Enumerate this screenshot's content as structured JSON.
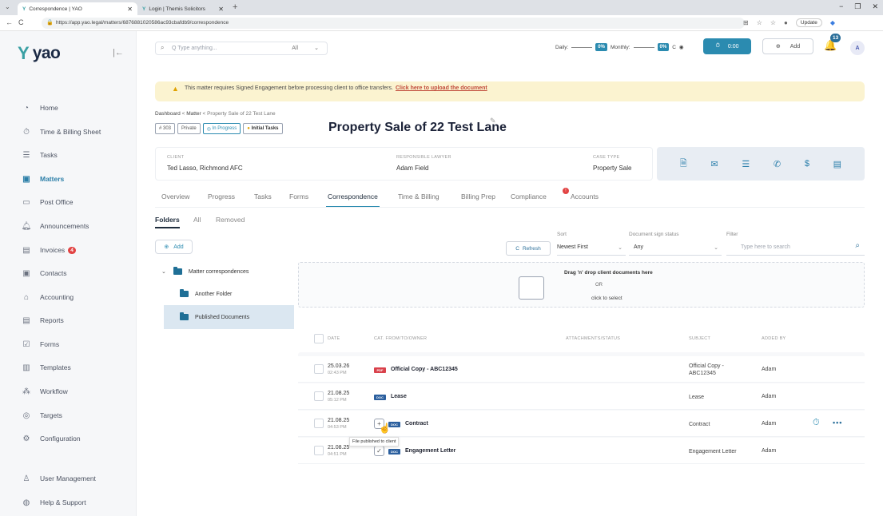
{
  "browser": {
    "tabs": [
      {
        "title": "Correspondence | YAO"
      },
      {
        "title": "Login | Themis Solicitors"
      }
    ],
    "url": "https://app.yao.legal/matters/6876881020586ac93cbafdb9/correspondence",
    "update_label": "Update"
  },
  "sidebar": {
    "logo": "yao",
    "items": [
      {
        "label": "Home",
        "icon": "home-icon"
      },
      {
        "label": "Time & Billing Sheet",
        "icon": "stopwatch-icon"
      },
      {
        "label": "Tasks",
        "icon": "tasks-icon"
      },
      {
        "label": "Matters",
        "icon": "briefcase-icon",
        "active": true
      },
      {
        "label": "Post Office",
        "icon": "mailbox-icon"
      },
      {
        "label": "Announcements",
        "icon": "bell-icon"
      },
      {
        "label": "Invoices",
        "icon": "invoice-icon",
        "badge": "4"
      },
      {
        "label": "Contacts",
        "icon": "contacts-icon"
      },
      {
        "label": "Accounting",
        "icon": "bank-icon"
      },
      {
        "label": "Reports",
        "icon": "report-icon"
      },
      {
        "label": "Forms",
        "icon": "form-icon"
      },
      {
        "label": "Templates",
        "icon": "template-icon"
      },
      {
        "label": "Workflow",
        "icon": "workflow-icon"
      },
      {
        "label": "Targets",
        "icon": "target-icon"
      },
      {
        "label": "Configuration",
        "icon": "gear-icon"
      },
      {
        "label": "User Management",
        "icon": "user-icon"
      },
      {
        "label": "Help & Support",
        "icon": "help-icon"
      }
    ]
  },
  "header": {
    "search_placeholder": "Q  Type anything...",
    "search_scope": "All",
    "daily_label": "Daily:",
    "daily_value": "0%",
    "monthly_label": "Monthly:",
    "monthly_value": "0%",
    "timer_value": "0:00",
    "add_label": "Add",
    "notifications": "13",
    "avatar": "A"
  },
  "banner": {
    "text": "This matter requires Signed Engagement before processing client to office transfers.",
    "link": "Click here to upload the document"
  },
  "matter": {
    "breadcrumb": [
      "Dashboard",
      "Matter",
      "Property Sale of 22 Test Lane"
    ],
    "number": "# 303",
    "privacy": "Private",
    "status": "In Progress",
    "stage": "Initial Tasks",
    "title": "Property Sale of 22 Test Lane",
    "client_label": "CLIENT",
    "client": "Ted Lasso,  Richmond AFC",
    "lawyer_label": "RESPONSIBLE LAWYER",
    "lawyer": "Adam Field",
    "case_type_label": "CASE TYPE",
    "case_type": "Property Sale"
  },
  "tabs": [
    "Overview",
    "Progress",
    "Tasks",
    "Forms",
    "Correspondence",
    "Time & Billing",
    "Billing Prep",
    "Compliance",
    "Accounts"
  ],
  "active_tab": "Correspondence",
  "subtabs": [
    "Folders",
    "All",
    "Removed"
  ],
  "toolbar": {
    "add_label": "Add",
    "refresh_label": "Refresh",
    "sort_label": "Sort",
    "sort_value": "Newest First",
    "sign_label": "Document sign status",
    "sign_value": "Any",
    "filter_label": "Filter",
    "filter_placeholder": "Type here to search"
  },
  "folders": {
    "root": "Matter correspondences",
    "children": [
      "Another Folder",
      "Published Documents"
    ]
  },
  "dropzone": {
    "line1": "Drag 'n' drop client documents here",
    "line2": "OR",
    "line3": "click to select"
  },
  "table": {
    "headers": [
      "DATE",
      "CAT. FROM/TO/OWNER",
      "ATTACHMENTS/STATUS",
      "SUBJECT",
      "ADDED BY"
    ],
    "rows": [
      {
        "date": "25.03.26",
        "time": "02:43 PM",
        "type": "PDF",
        "name": "Official Copy - ABC12345",
        "subject": "Official Copy - ABC12345",
        "by": "Adam"
      },
      {
        "date": "21.08.25",
        "time": "05:12 PM",
        "type": "DOC",
        "name": "Lease",
        "subject": "Lease",
        "by": "Adam"
      },
      {
        "date": "21.08.25",
        "time": "04:53 PM",
        "type": "DOC",
        "name": "Contract",
        "subject": "Contract",
        "by": "Adam"
      },
      {
        "date": "21.08.25",
        "time": "04:51 PM",
        "type": "DOC",
        "name": "Engagement Letter",
        "subject": "Engagement Letter",
        "by": "Adam"
      }
    ],
    "tooltip": "File published to client"
  },
  "colors": {
    "accent": "#2b8bb0",
    "pdf": "#d9414b",
    "doc": "#2b5f9e",
    "banner": "#fbf3d0"
  }
}
